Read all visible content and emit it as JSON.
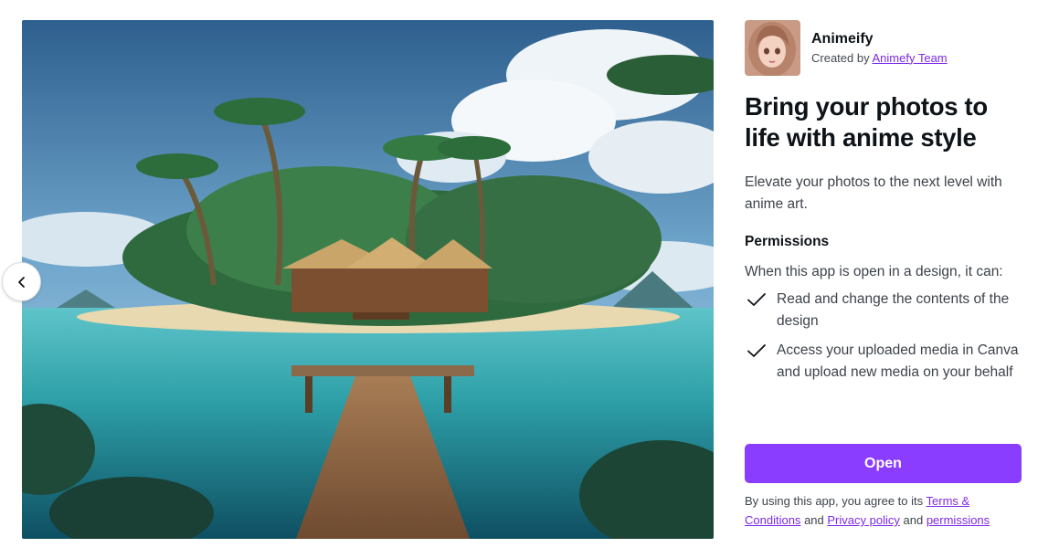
{
  "app": {
    "name": "Animeify",
    "created_by_prefix": "Created by",
    "creator": "Animefy Team"
  },
  "headline": "Bring your photos to life with anime style",
  "description": "Elevate your photos to the next level with anime art.",
  "permissions": {
    "title": "Permissions",
    "intro": "When this app is open in a design, it can:",
    "items": [
      "Read and change the contents of the design",
      "Access your uploaded media in Canva and upload new media on your behalf"
    ]
  },
  "open_button": "Open",
  "legal": {
    "prefix": "By using this app, you agree to its",
    "terms": "Terms & Conditions",
    "and1": "and",
    "privacy": "Privacy policy",
    "and2": "and",
    "permissions_link": "permissions"
  },
  "colors": {
    "accent": "#8b3dff",
    "link": "#7d2ae8",
    "text": "#0e1318"
  },
  "icons": {
    "carousel_prev": "chevron-left-icon",
    "permission": "check-icon"
  }
}
